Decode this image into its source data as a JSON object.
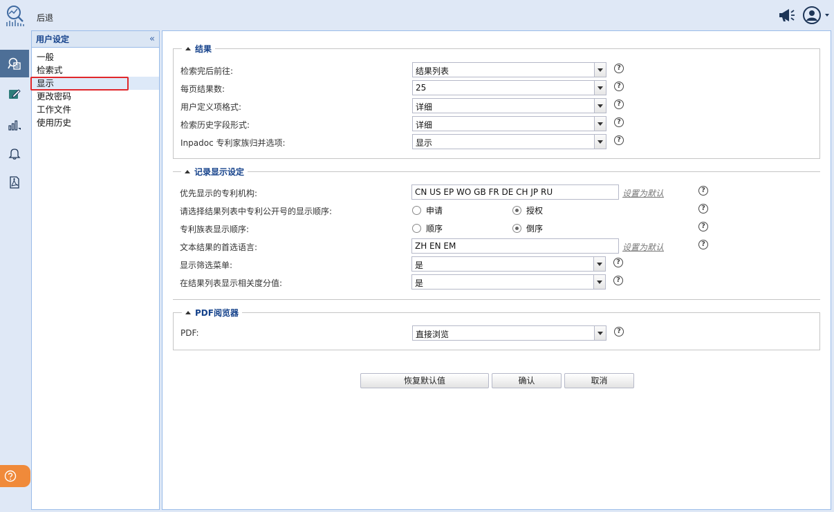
{
  "header": {
    "back_label": "后退"
  },
  "icons": {
    "logo": "chart-magnifier-logo-icon",
    "megaphone": "megaphone-icon",
    "user": "user-icon"
  },
  "nav": {
    "title": "用户设定",
    "collapse_glyph": "«",
    "items": [
      {
        "label": "一般"
      },
      {
        "label": "检索式"
      },
      {
        "label": "显示"
      },
      {
        "label": "更改密码"
      },
      {
        "label": "工作文件"
      },
      {
        "label": "使用历史"
      }
    ]
  },
  "sections": {
    "results": {
      "title": "结果",
      "rows": [
        {
          "label": "检索完后前往:",
          "value": "结果列表"
        },
        {
          "label": "每页结果数:",
          "value": "25"
        },
        {
          "label": "用户定义项格式:",
          "value": "详细"
        },
        {
          "label": "检索历史字段形式:",
          "value": "详细"
        },
        {
          "label": "Inpadoc 专利家族归并选项:",
          "value": "显示"
        }
      ]
    },
    "record_display": {
      "title": "记录显示设定",
      "authority": {
        "label": "优先显示的专利机构:",
        "value": "CN US EP WO GB FR DE CH JP RU",
        "link": "设置为默认"
      },
      "order": {
        "label": "请选择结果列表中专利公开号的显示顺序:",
        "opt1": "申请",
        "opt2": "授权"
      },
      "family_order": {
        "label": "专利族表显示顺序:",
        "opt1": "顺序",
        "opt2": "倒序"
      },
      "language": {
        "label": "文本结果的首选语言:",
        "value": "ZH EN EM",
        "link": "设置为默认"
      },
      "filter_menu": {
        "label": "显示筛选菜单:",
        "value": "是"
      },
      "relevance": {
        "label": "在结果列表显示相关度分值:",
        "value": "是"
      }
    },
    "pdf": {
      "title": "PDF阅览器",
      "row": {
        "label": "PDF:",
        "value": "直接浏览"
      }
    }
  },
  "help_glyph": "?",
  "buttons": {
    "restore": "恢复默认值",
    "confirm": "确认",
    "cancel": "取消"
  },
  "colors": {
    "accent_rail": "#4d6f97",
    "help_pill": "#f08a3a",
    "selection_mark": "#e0262a",
    "title_blue": "#15428b"
  }
}
